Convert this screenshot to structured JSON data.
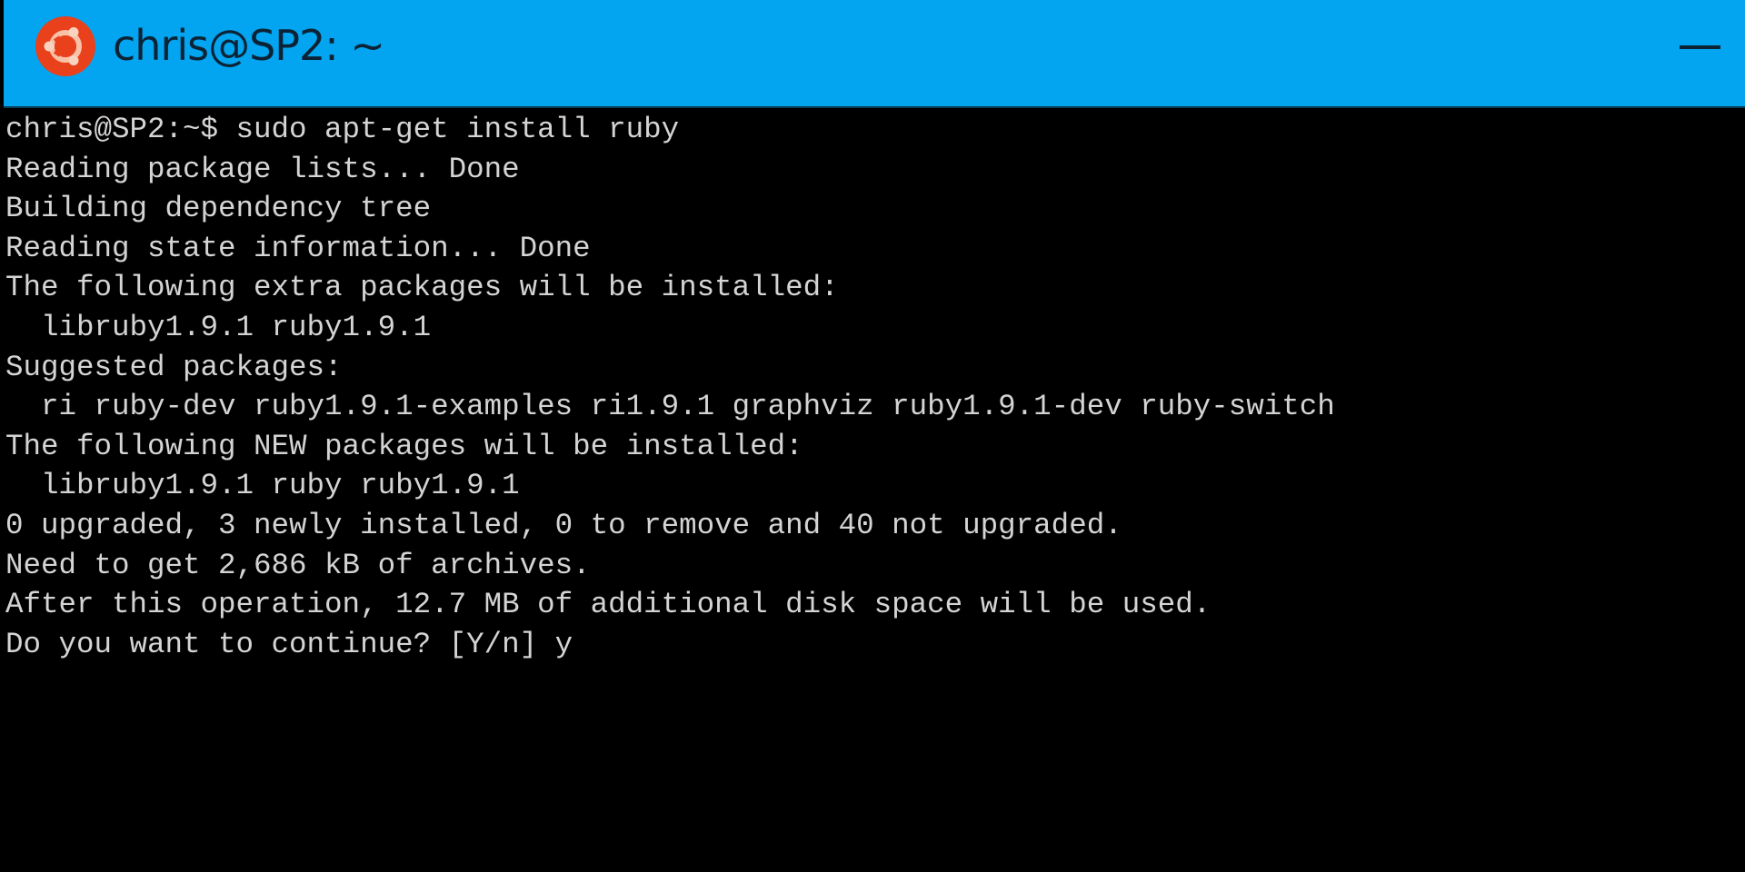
{
  "window": {
    "title": "chris@SP2: ~",
    "icon": "ubuntu-logo-icon",
    "titlebar_color": "#03a5f0",
    "controls": {
      "minimize_icon": "minimize-icon"
    }
  },
  "terminal": {
    "lines": [
      "chris@SP2:~$ sudo apt-get install ruby",
      "Reading package lists... Done",
      "Building dependency tree",
      "Reading state information... Done",
      "The following extra packages will be installed:",
      "  libruby1.9.1 ruby1.9.1",
      "Suggested packages:",
      "  ri ruby-dev ruby1.9.1-examples ri1.9.1 graphviz ruby1.9.1-dev ruby-switch",
      "The following NEW packages will be installed:",
      "  libruby1.9.1 ruby ruby1.9.1",
      "0 upgraded, 3 newly installed, 0 to remove and 40 not upgraded.",
      "Need to get 2,686 kB of archives.",
      "After this operation, 12.7 MB of additional disk space will be used.",
      "Do you want to continue? [Y/n] y"
    ],
    "text_color": "#d4d4d4",
    "background_color": "#000000"
  }
}
